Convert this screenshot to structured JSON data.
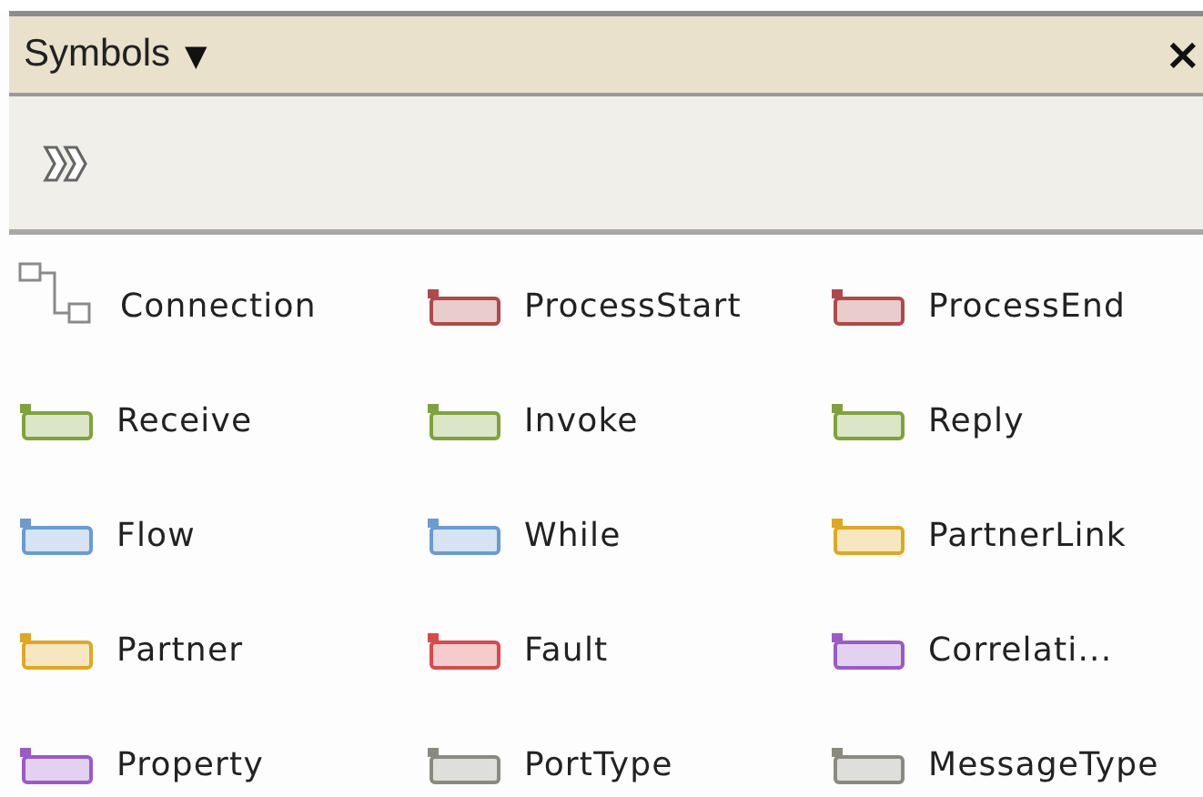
{
  "panel": {
    "title": "Symbols",
    "dropdown_glyph": "▼",
    "close_glyph": "×"
  },
  "symbols": [
    {
      "label": "Connection",
      "kind": "connection",
      "color": "#8a8a8a"
    },
    {
      "label": "ProcessStart",
      "kind": "block",
      "color": "#b04a4a"
    },
    {
      "label": "ProcessEnd",
      "kind": "block",
      "color": "#b04a4a"
    },
    {
      "label": "Receive",
      "kind": "block",
      "color": "#7fa33a"
    },
    {
      "label": "Invoke",
      "kind": "block",
      "color": "#7fa33a"
    },
    {
      "label": "Reply",
      "kind": "block",
      "color": "#7fa33a"
    },
    {
      "label": "Flow",
      "kind": "block",
      "color": "#6a9bd1"
    },
    {
      "label": "While",
      "kind": "block",
      "color": "#6a9bd1"
    },
    {
      "label": "PartnerLink",
      "kind": "block",
      "color": "#e0a820"
    },
    {
      "label": "Partner",
      "kind": "block",
      "color": "#e0a820"
    },
    {
      "label": "Fault",
      "kind": "block",
      "color": "#d94a4a"
    },
    {
      "label": "Correlati...",
      "kind": "block",
      "color": "#9a5ac8"
    },
    {
      "label": "Property",
      "kind": "block",
      "color": "#9a5ac8"
    },
    {
      "label": "PortType",
      "kind": "block",
      "color": "#8a8a80"
    },
    {
      "label": "MessageType",
      "kind": "block",
      "color": "#8a8a80"
    }
  ]
}
